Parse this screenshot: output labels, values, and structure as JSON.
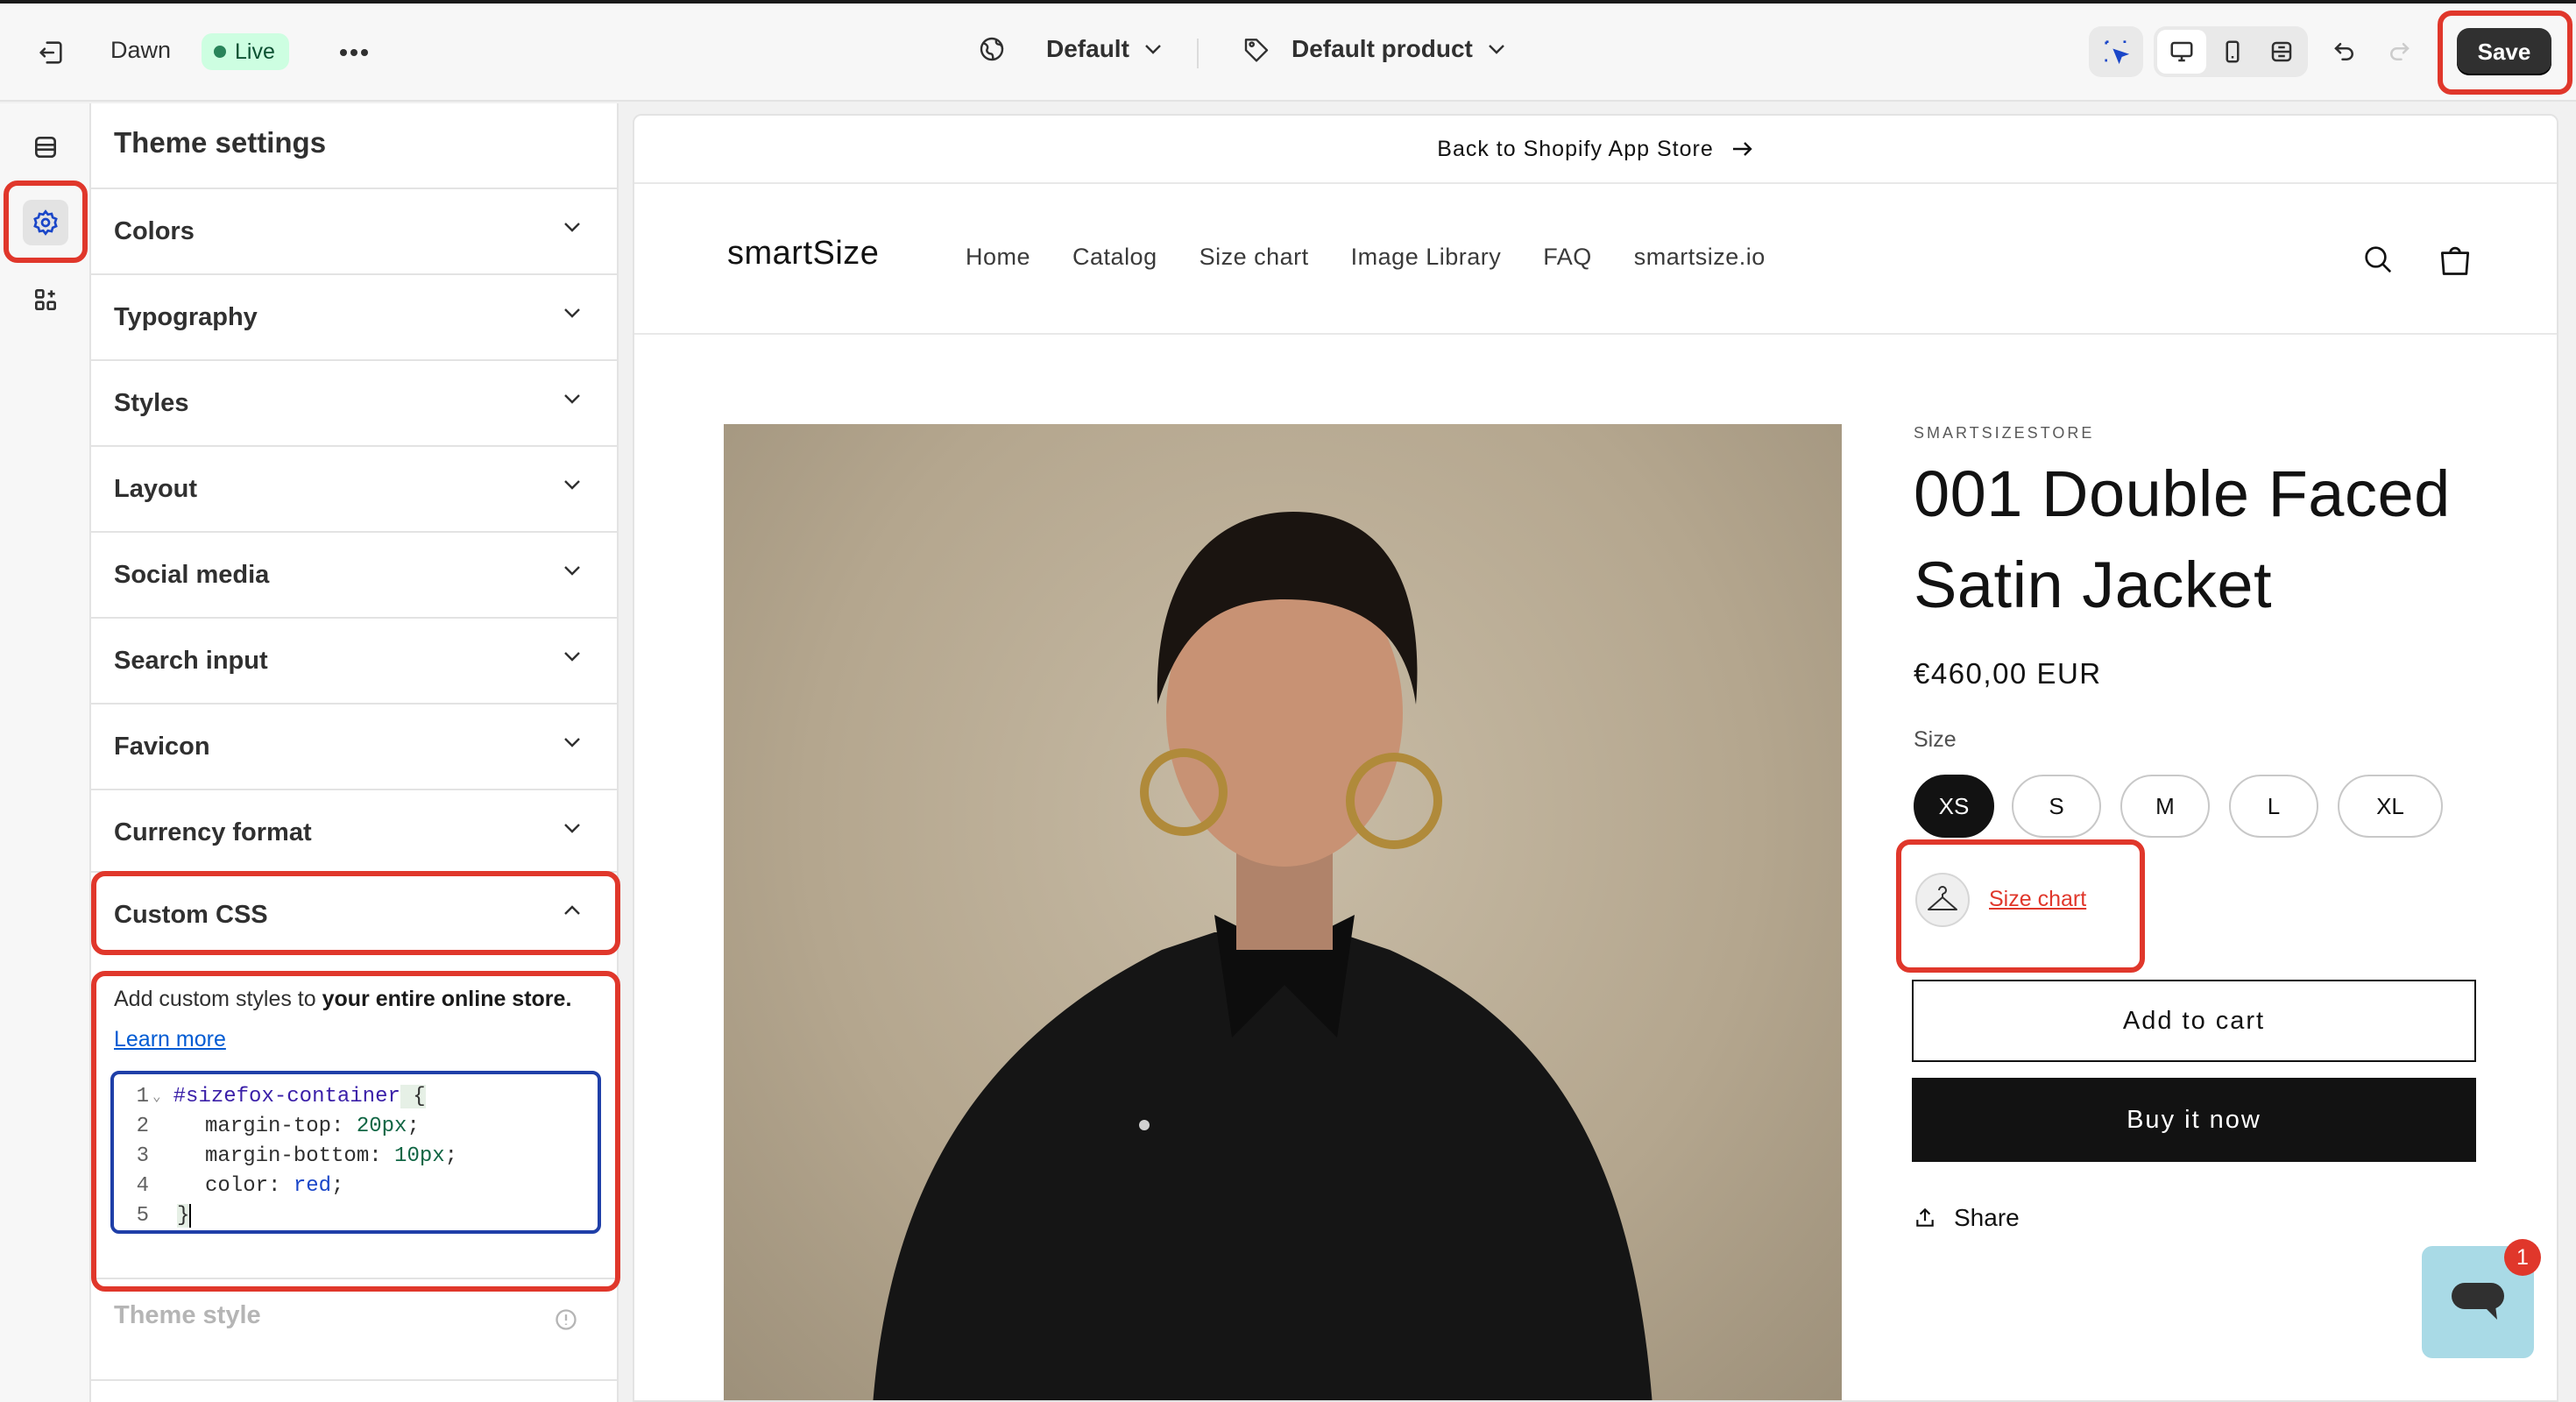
{
  "topbar": {
    "theme_name": "Dawn",
    "live_label": "Live",
    "template_label": "Default",
    "product_label": "Default product",
    "save_label": "Save"
  },
  "panel": {
    "title": "Theme settings",
    "sections": [
      "Colors",
      "Typography",
      "Styles",
      "Layout",
      "Social media",
      "Search input",
      "Favicon",
      "Currency format"
    ],
    "custom_css": {
      "title": "Custom CSS",
      "description_pre": "Add custom styles to ",
      "description_bold": "your entire online store.",
      "learn_more": "Learn more",
      "code": {
        "l1_num": "1",
        "l1_sel": "#sizefox-container",
        "l1_brace": " {",
        "l2_num": "2",
        "l2_prop": "margin-top: ",
        "l2_val": "20px",
        "l2_end": ";",
        "l3_num": "3",
        "l3_prop": "margin-bottom: ",
        "l3_val": "10px",
        "l3_end": ";",
        "l4_num": "4",
        "l4_prop": "color: ",
        "l4_val": "red",
        "l4_end": ";",
        "l5_num": "5",
        "l5_text": "}"
      }
    },
    "theme_style_label": "Theme style"
  },
  "store": {
    "announcement": "Back to Shopify App Store",
    "logo": "smartSize",
    "nav": [
      "Home",
      "Catalog",
      "Size chart",
      "Image Library",
      "FAQ",
      "smartsize.io"
    ]
  },
  "product": {
    "vendor": "SMARTSIZESTORE",
    "title": "001 Double Faced Satin Jacket",
    "price": "€460,00 EUR",
    "size_label": "Size",
    "sizes": [
      "XS",
      "S",
      "M",
      "L",
      "XL"
    ],
    "selected_size": "XS",
    "size_chart_link": "Size chart",
    "add_to_cart": "Add to cart",
    "buy_now": "Buy it now",
    "share": "Share"
  },
  "chat": {
    "badge_count": "1"
  },
  "colors": {
    "highlight": "#e0372b",
    "live_bg": "#cdfee1",
    "accent_link": "#005bd3"
  }
}
